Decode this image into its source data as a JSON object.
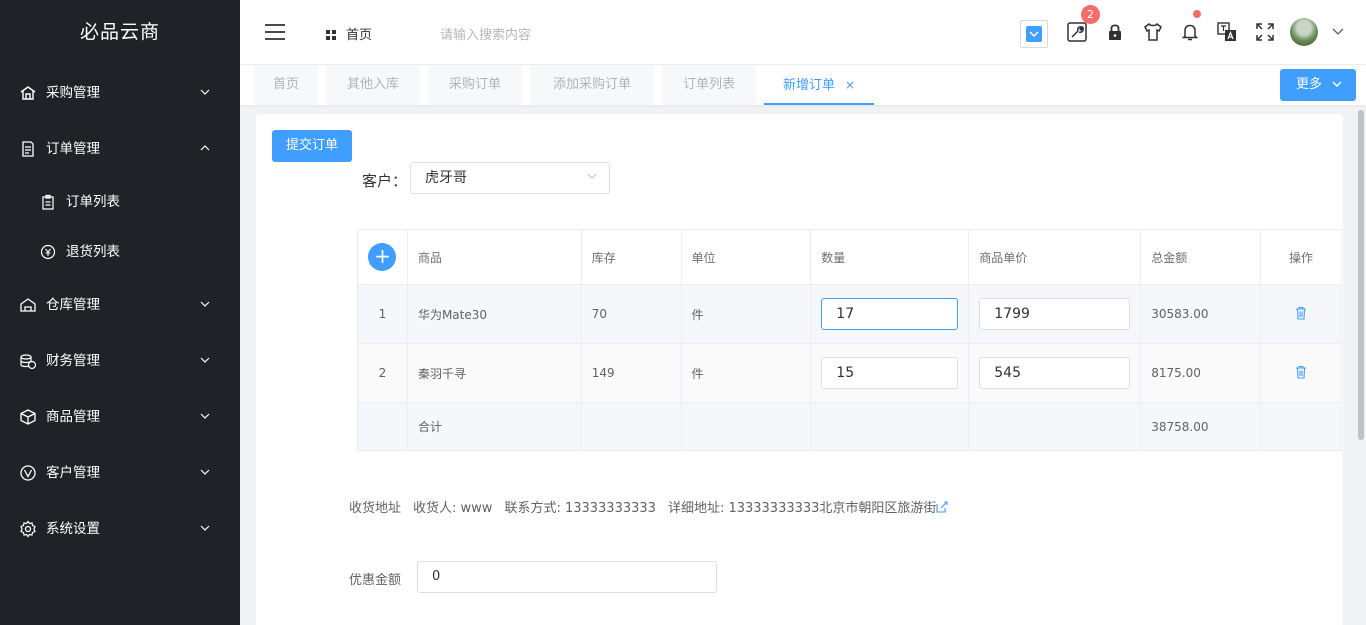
{
  "app": {
    "title": "必品云商"
  },
  "sidebar": {
    "items": [
      {
        "label": "采购管理",
        "icon": "building-icon",
        "expanded": false
      },
      {
        "label": "订单管理",
        "icon": "document-icon",
        "expanded": true,
        "children": [
          {
            "label": "订单列表",
            "icon": "clipboard-icon"
          },
          {
            "label": "退货列表",
            "icon": "coin-icon"
          }
        ]
      },
      {
        "label": "仓库管理",
        "icon": "warehouse-icon",
        "expanded": false
      },
      {
        "label": "财务管理",
        "icon": "finance-icon",
        "expanded": false
      },
      {
        "label": "商品管理",
        "icon": "box-icon",
        "expanded": false
      },
      {
        "label": "客户管理",
        "icon": "customer-icon",
        "expanded": false
      },
      {
        "label": "系统设置",
        "icon": "gear-icon",
        "expanded": false
      }
    ]
  },
  "header": {
    "home_label": "首页",
    "search_placeholder": "请输入搜索内容",
    "notification_badge": "2"
  },
  "tabs": {
    "items": [
      "首页",
      "其他入库",
      "采购订单",
      "添加采购订单",
      "订单列表",
      "新增订单"
    ],
    "active_index": 5,
    "close_glyph": "×",
    "more_label": "更多"
  },
  "form": {
    "submit_label": "提交订单",
    "customer_label": "客户：",
    "customer_value": "虎牙哥"
  },
  "table": {
    "add_glyph": "+",
    "headers": [
      "商品",
      "库存",
      "单位",
      "数量",
      "商品单价",
      "总金额",
      "操作"
    ],
    "rows": [
      {
        "index": "1",
        "product": "华为Mate30",
        "stock": "70",
        "unit": "件",
        "quantity": "17",
        "price": "1799",
        "total": "30583.00"
      },
      {
        "index": "2",
        "product": "秦羽千寻",
        "stock": "149",
        "unit": "件",
        "quantity": "15",
        "price": "545",
        "total": "8175.00"
      }
    ],
    "summary_label": "合计",
    "summary_total": "38758.00"
  },
  "shipping": {
    "label": "收货地址",
    "receiver": "收货人: www",
    "contact": "联系方式: 13333333333",
    "address": "详细地址: 13333333333北京市朝阳区旅游街"
  },
  "discount": {
    "label": "优惠金额",
    "value": "0"
  },
  "colors": {
    "accent": "#409eff",
    "sidebar_bg": "#1f2327",
    "danger": "#f56c6c"
  }
}
